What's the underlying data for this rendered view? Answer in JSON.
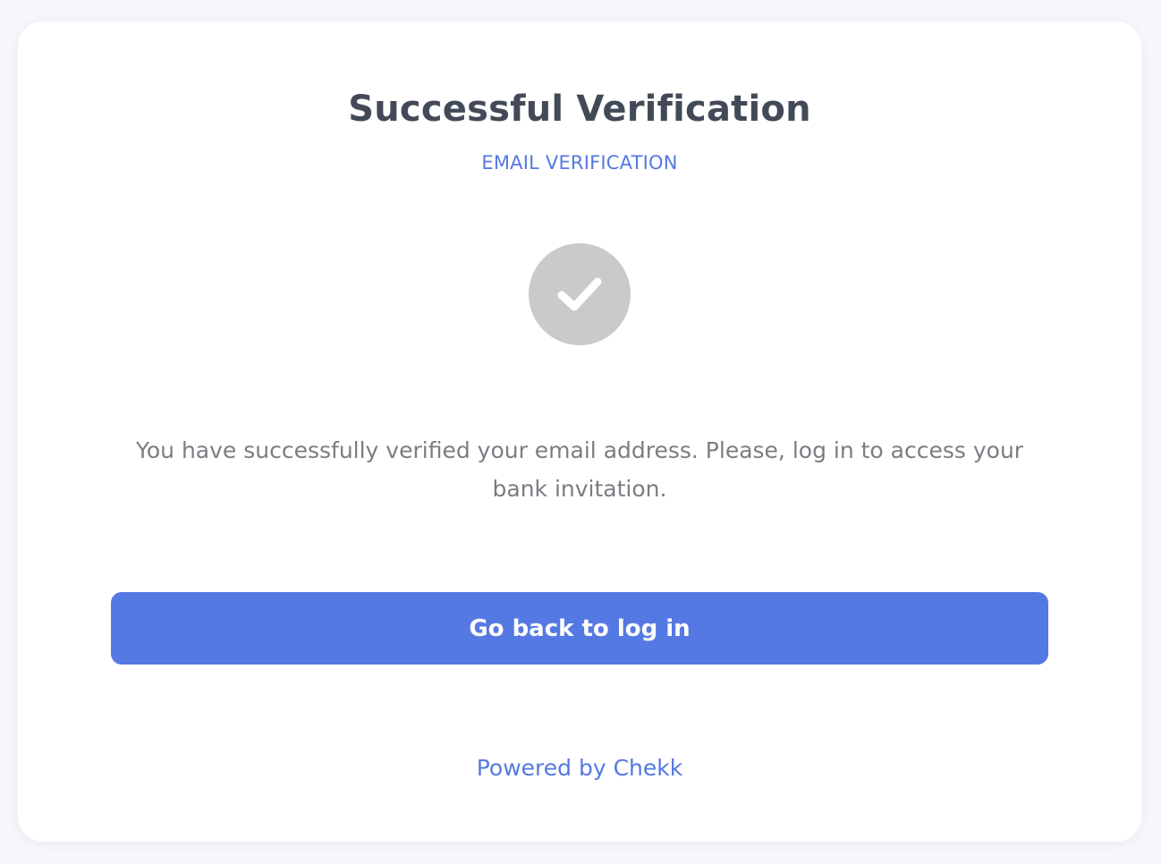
{
  "verification": {
    "title": "Successful Verification",
    "subtitle": "EMAIL VERIFICATION",
    "status_icon": "checkmark-icon",
    "message": "You have successfully verified your email address. Please, log in to access your bank invitation.",
    "button_label": "Go back to log in",
    "powered_by": "Powered by Chekk"
  },
  "colors": {
    "accent": "#5579e3",
    "title": "#434a57",
    "body_text": "#7a7e83",
    "icon_circle": "#cacaca",
    "background": "#f6f7fb",
    "card": "#ffffff"
  }
}
